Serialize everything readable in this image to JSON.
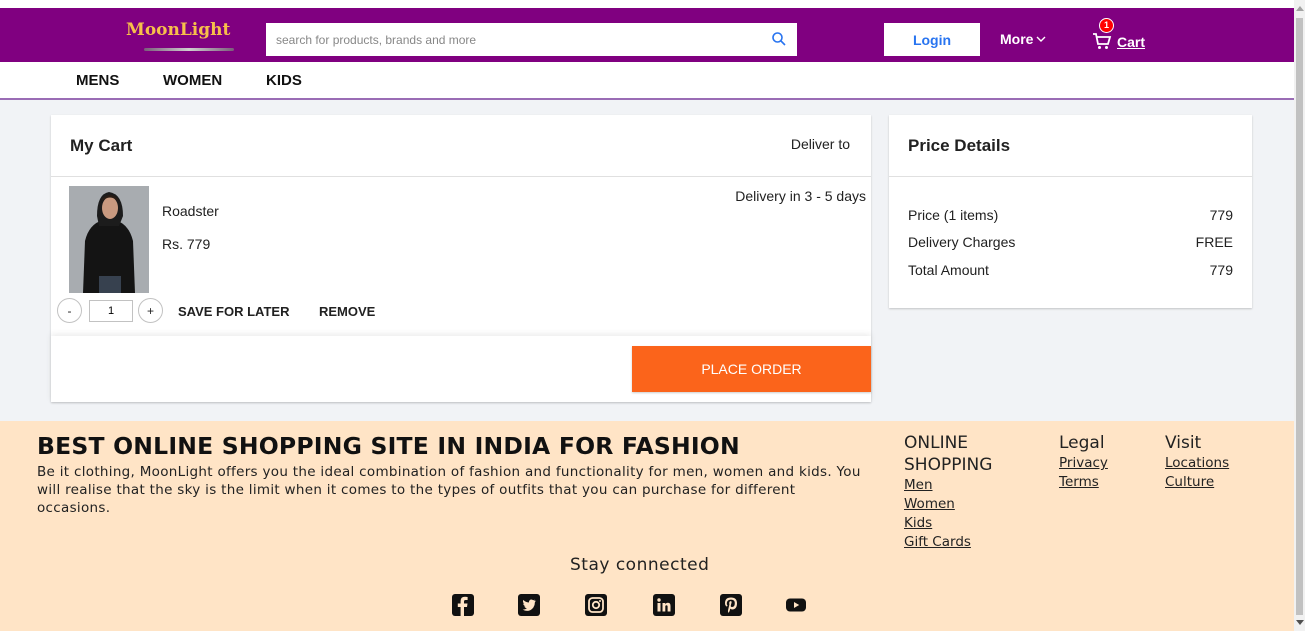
{
  "header": {
    "logo": "MoonLight",
    "search_placeholder": "search for products, brands and more",
    "login_label": "Login",
    "more_label": "More",
    "cart_label": "Cart",
    "cart_count": "1",
    "brand_color": "#800080"
  },
  "categories": [
    "MENS",
    "WOMEN",
    "KIDS"
  ],
  "cart": {
    "title": "My Cart",
    "deliver_to": "Deliver to",
    "item": {
      "brand": "Roadster",
      "price": "Rs. 779",
      "delivery": "Delivery in 3 - 5 days",
      "quantity": "1",
      "decrement": "-",
      "increment": "+"
    },
    "save_for_later": "SAVE FOR LATER",
    "remove": "REMOVE",
    "place_order": "PLACE ORDER"
  },
  "price_details": {
    "title": "Price Details",
    "rows": [
      {
        "label": "Price (1 items)",
        "value": "779"
      },
      {
        "label": "Delivery Charges",
        "value": "FREE"
      },
      {
        "label": "Total Amount",
        "value": "779"
      }
    ]
  },
  "footer": {
    "title": "BEST ONLINE SHOPPING SITE IN INDIA FOR FASHION",
    "description": "Be it clothing, MoonLight offers you the ideal combination of fashion and functionality for men, women and kids. You will realise that the sky is the limit when it comes to the types of outfits that you can purchase for different occasions.",
    "columns": [
      {
        "heading": "ONLINE SHOPPING",
        "links": [
          "Men",
          "Women",
          "Kids",
          "Gift Cards"
        ]
      },
      {
        "heading": "Legal",
        "links": [
          "Privacy",
          "Terms"
        ]
      },
      {
        "heading": "Visit",
        "links": [
          "Locations",
          "Culture"
        ]
      }
    ],
    "stay_connected": "Stay connected",
    "social_icons": [
      "facebook-icon",
      "twitter-icon",
      "instagram-icon",
      "linkedin-icon",
      "pinterest-icon",
      "youtube-icon"
    ]
  }
}
